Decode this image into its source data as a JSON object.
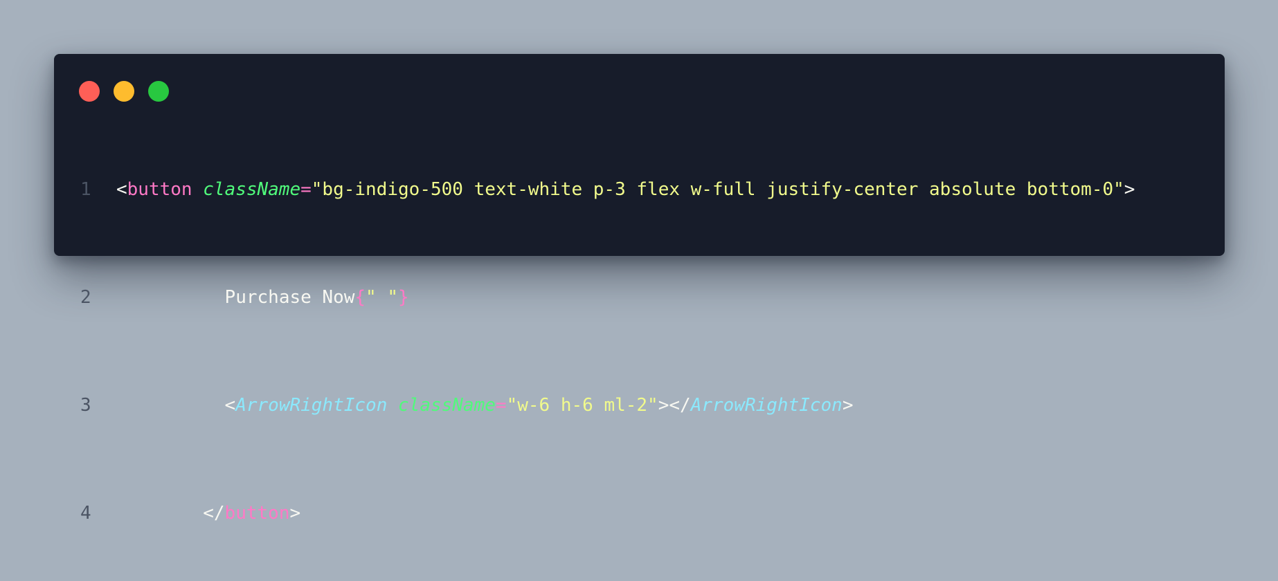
{
  "window": {
    "controls": {
      "close_color": "#fe5f57",
      "minimize_color": "#febc2e",
      "maximize_color": "#28c840"
    }
  },
  "code": {
    "lines": [
      {
        "number": "1",
        "indent": "",
        "tokens": {
          "open_bracket": "<",
          "tag": "button",
          "attr": "className",
          "eq": "=",
          "value": "\"bg-indigo-500 text-white p-3 flex w-full justify-center absolute bottom-0\"",
          "close_bracket": ">"
        }
      },
      {
        "number": "2",
        "indent": "          ",
        "tokens": {
          "text": "Purchase Now",
          "brace_open": "{",
          "string": "\" \"",
          "brace_close": "}"
        }
      },
      {
        "number": "3",
        "indent": "          ",
        "tokens": {
          "open_bracket": "<",
          "component": "ArrowRightIcon",
          "attr": "className",
          "eq": "=",
          "value": "\"w-6 h-6 ml-2\"",
          "mid": "></",
          "component_close": "ArrowRightIcon",
          "close_bracket": ">"
        }
      },
      {
        "number": "4",
        "indent": "        ",
        "tokens": {
          "open_bracket": "</",
          "tag": "button",
          "close_bracket": ">"
        }
      }
    ]
  }
}
